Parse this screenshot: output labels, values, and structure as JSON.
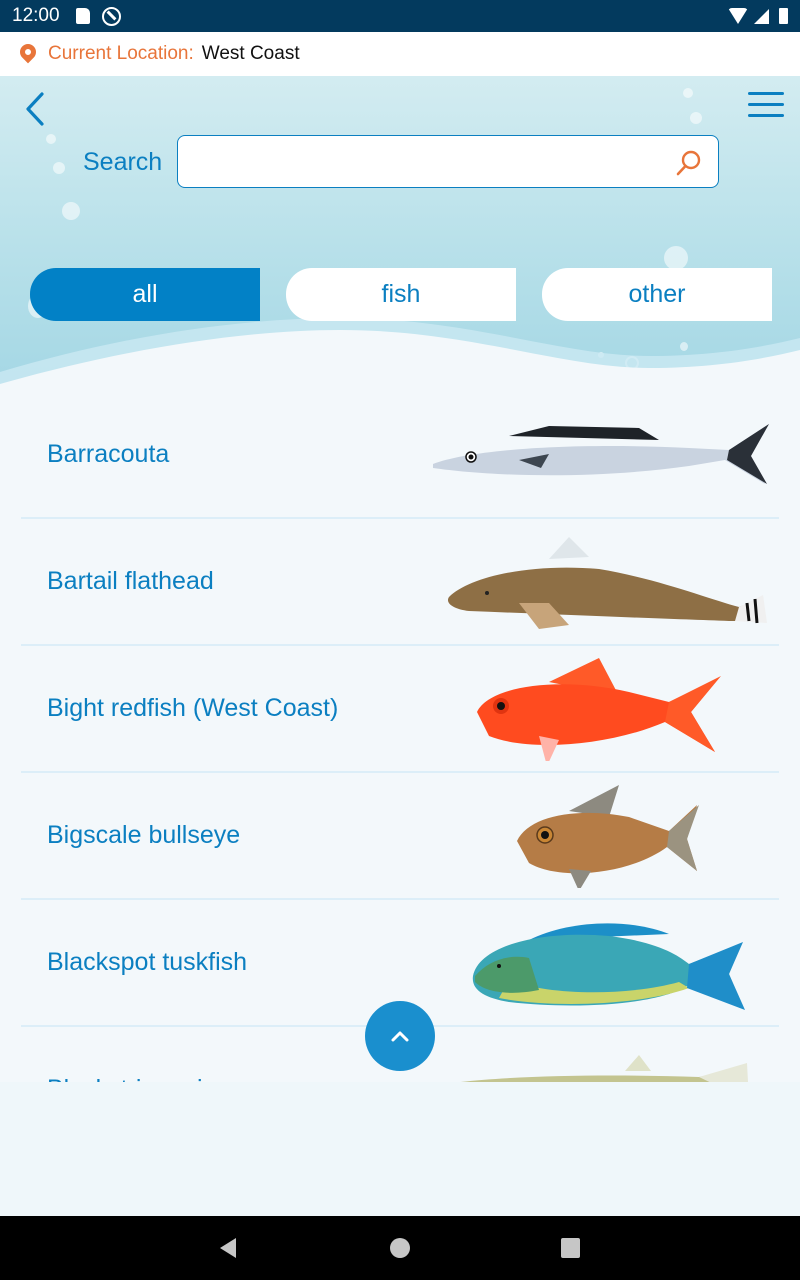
{
  "status_bar": {
    "time": "12:00",
    "icons": [
      "sd-card-icon",
      "sync-disabled-icon",
      "wifi-icon",
      "signal-icon",
      "battery-icon"
    ]
  },
  "location": {
    "icon": "location-pin-icon",
    "label": "Current Location:",
    "value": "West Coast",
    "label_color": "#e8753a"
  },
  "header": {
    "back_icon": "chevron-left-icon",
    "menu_icon": "hamburger-menu-icon",
    "search": {
      "label": "Search",
      "value": "",
      "placeholder": "",
      "icon": "search-icon",
      "icon_color": "#e8753a"
    }
  },
  "filters": {
    "items": [
      {
        "label": "all",
        "active": true
      },
      {
        "label": "fish",
        "active": false
      },
      {
        "label": "other",
        "active": false
      }
    ],
    "accent_color": "#0281c6"
  },
  "species_list": [
    {
      "name": "Barracouta",
      "image": "barracouta-fish-illustration"
    },
    {
      "name": "Bartail flathead",
      "image": "bartail-flathead-fish-illustration"
    },
    {
      "name": "Bight redfish (West Coast)",
      "image": "bight-redfish-fish-illustration"
    },
    {
      "name": "Bigscale bullseye",
      "image": "bigscale-bullseye-fish-illustration"
    },
    {
      "name": "Blackspot tuskfish",
      "image": "blackspot-tuskfish-fish-illustration"
    },
    {
      "name": "Blackstripe minnow",
      "image": "blackstripe-minnow-fish-illustration"
    }
  ],
  "scroll_top_button": {
    "icon": "chevron-up-icon"
  },
  "nav_bar": {
    "icons": [
      "back-triangle-icon",
      "home-circle-icon",
      "recents-square-icon"
    ]
  }
}
